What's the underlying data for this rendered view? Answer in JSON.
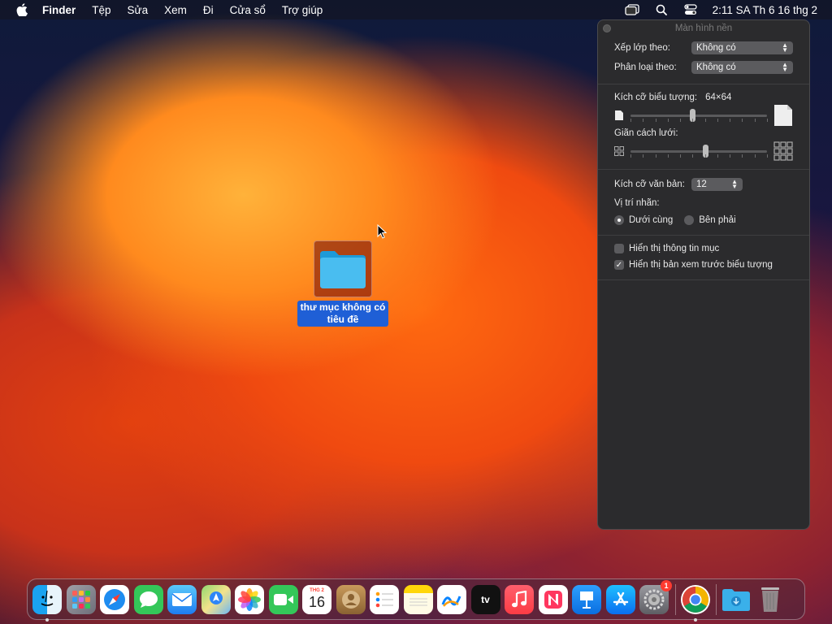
{
  "menubar": {
    "app": "Finder",
    "items": [
      "Tệp",
      "Sửa",
      "Xem",
      "Đi",
      "Cửa sổ",
      "Trợ giúp"
    ],
    "clock": "2:11 SA Th 6 16 thg 2",
    "icons": [
      "apple-icon",
      "window-switch-icon",
      "search-icon",
      "control-center-icon"
    ]
  },
  "desktop": {
    "folder_label": "thư mục không có tiêu đề"
  },
  "panel": {
    "title": "Màn hình nền",
    "arrange_label": "Xếp lớp theo:",
    "arrange_value": "Không có",
    "sort_label": "Phân loại theo:",
    "sort_value": "Không có",
    "icon_size_label": "Kích cỡ biểu tượng:",
    "icon_size_value": "64×64",
    "icon_size_level": 0.45,
    "grid_spacing_label": "Giãn cách lưới:",
    "grid_spacing_level": 0.55,
    "text_size_label": "Kích cỡ văn bản:",
    "text_size_value": "12",
    "label_pos_label": "Vị trí nhãn:",
    "label_bottom": "Dưới cùng",
    "label_right": "Bên phải",
    "show_info_label": "Hiển thị thông tin mục",
    "show_preview_label": "Hiển thị bản xem trước biểu tượng"
  },
  "dock": {
    "calendar_month": "THG 2",
    "calendar_day": "16",
    "settings_badge": "1",
    "tv_label": "tv"
  }
}
